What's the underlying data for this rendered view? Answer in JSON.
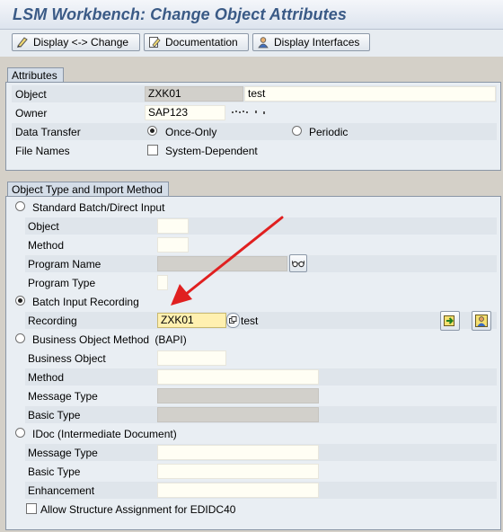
{
  "window": {
    "title": "LSM Workbench: Change Object Attributes"
  },
  "toolbar": {
    "display_change": "Display <-> Change",
    "documentation": "Documentation",
    "display_interfaces": "Display Interfaces"
  },
  "attributes": {
    "group_title": "Attributes",
    "object_label": "Object",
    "object_value": "ZXK01",
    "object_desc": "test",
    "owner_label": "Owner",
    "owner_value": "SAP123",
    "data_transfer_label": "Data Transfer",
    "once_only": "Once-Only",
    "periodic": "Periodic",
    "data_transfer_selected": "Once-Only",
    "file_names_label": "File Names",
    "system_dependent": "System-Dependent",
    "system_dependent_checked": false
  },
  "import_method": {
    "group_title": "Object Type and Import Method",
    "selected": "Batch Input Recording",
    "standard_batch": {
      "label": "Standard Batch/Direct Input",
      "object_label": "Object",
      "method_label": "Method",
      "program_name_label": "Program Name",
      "program_type_label": "Program Type"
    },
    "batch_input": {
      "label": "Batch Input Recording",
      "recording_label": "Recording",
      "recording_value": "ZXK01",
      "recording_desc": "test"
    },
    "bapi": {
      "label": "Business Object Method",
      "label_suffix": "(BAPI)",
      "business_object_label": "Business Object",
      "method_label": "Method",
      "message_type_label": "Message Type",
      "basic_type_label": "Basic Type"
    },
    "idoc": {
      "label": "IDoc (Intermediate Document)",
      "message_type_label": "Message Type",
      "basic_type_label": "Basic Type",
      "enhancement_label": "Enhancement"
    },
    "allow_structure": "Allow Structure Assignment for EDIDC40",
    "allow_structure_checked": false
  },
  "colors": {
    "title_text": "#3a5a86",
    "annotation_arrow": "#e02020",
    "required_field": "#fff0b0"
  }
}
